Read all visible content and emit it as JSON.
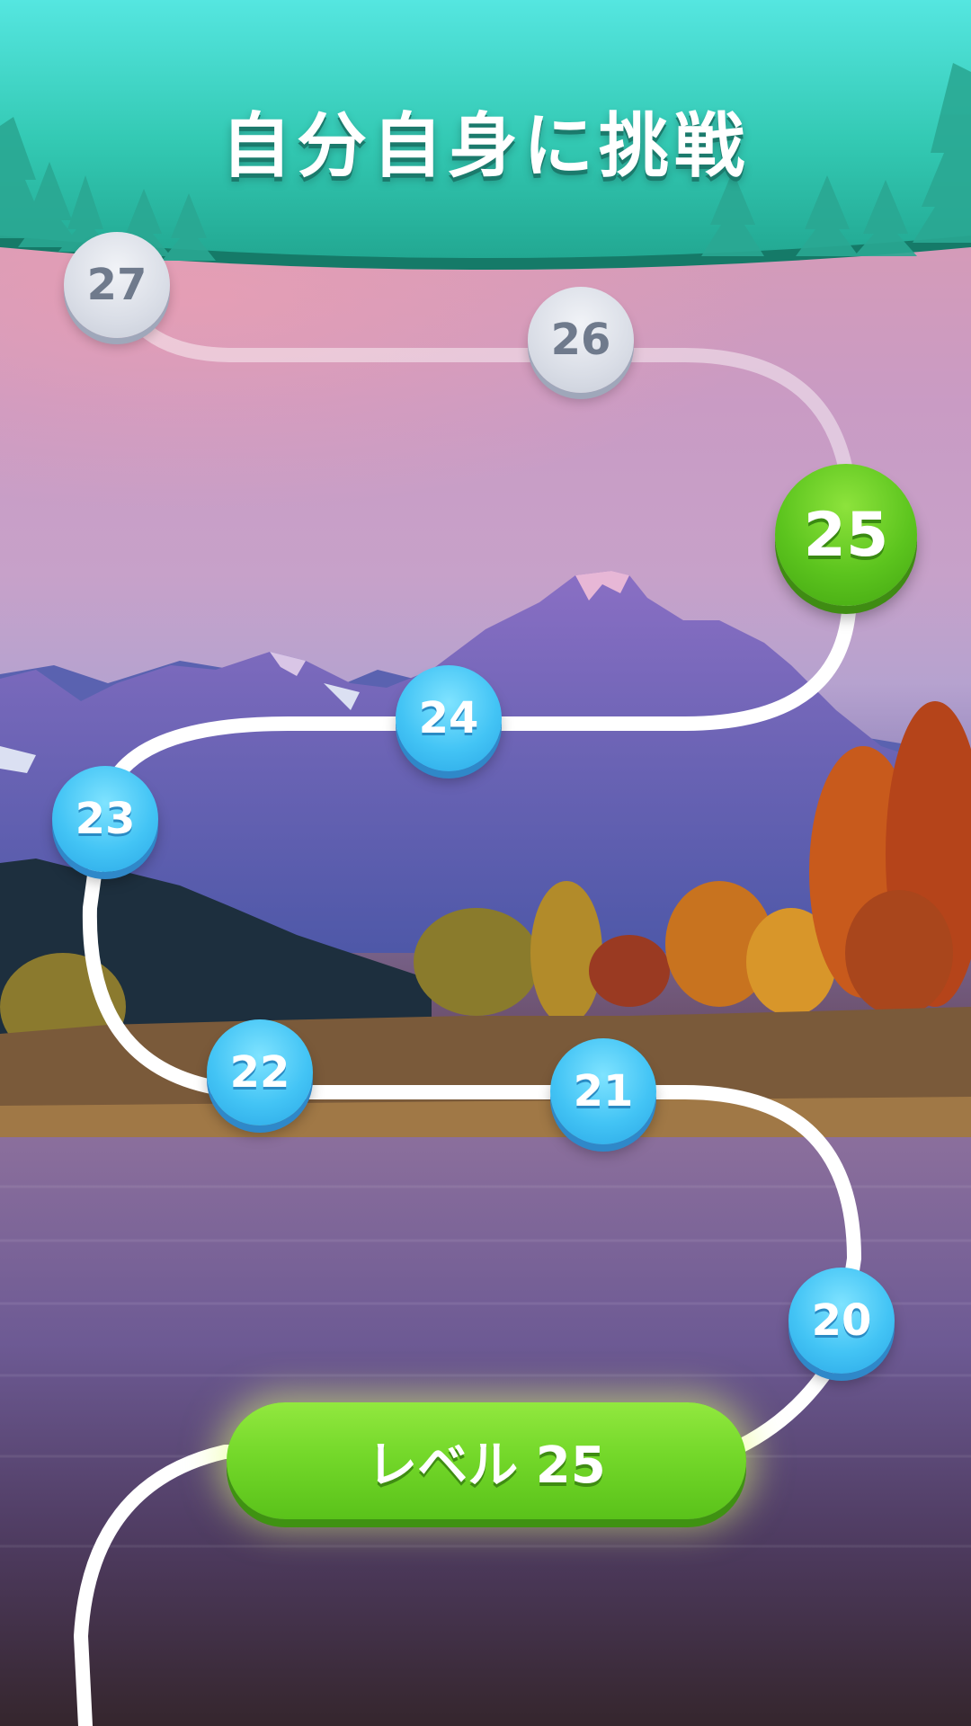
{
  "header": {
    "title": "自分自身に挑戦"
  },
  "levels": {
    "completed": [
      "20",
      "21",
      "22",
      "23",
      "24"
    ],
    "current": "25",
    "locked": [
      "26",
      "27"
    ]
  },
  "play_button": {
    "label": "レベル 25"
  },
  "colors": {
    "header_teal": "#2fc7b0",
    "completed_node_blue": "#43c4f5",
    "current_node_green": "#5cc41e",
    "locked_node_gray": "#d9dde6",
    "path_white": "#ffffff"
  }
}
